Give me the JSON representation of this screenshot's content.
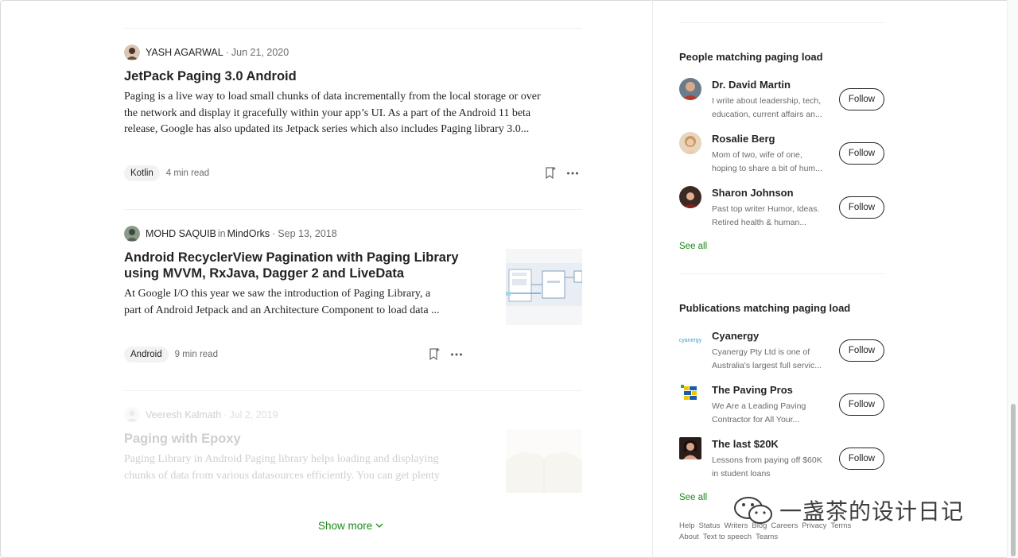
{
  "articles": [
    {
      "author": "YASH AGARWAL",
      "publication": "",
      "date": "Jun 21, 2020",
      "title_lines": [
        "JetPack Paging 3.0 Android"
      ],
      "excerpt_lines": [
        "Paging is a live way to load small chunks of data incrementally from the local storage or over",
        "the network and display it gracefully within your app’s UI. As a part of the Android 11 beta",
        "release, Google has also updated its Jetpack series which also includes Paging library 3.0..."
      ],
      "tag": "Kotlin",
      "read_time": "4 min read"
    },
    {
      "author": "MOHD SAQUIB",
      "in_label": "in",
      "publication": "MindOrks",
      "date": "Sep 13, 2018",
      "title_lines": [
        "Android RecyclerView Pagination with Paging Library",
        "using MVVM, RxJava, Dagger 2 and LiveData"
      ],
      "excerpt_lines": [
        "At Google I/O this year we saw the introduction of Paging Library, a",
        "part of Android Jetpack and an Architecture Component to load data ..."
      ],
      "tag": "Android",
      "read_time": "9 min read"
    },
    {
      "author": "Veeresh Kalmath",
      "publication": "",
      "date": "Jul 2, 2019",
      "title_lines": [
        "Paging with Epoxy"
      ],
      "excerpt_lines": [
        "Paging Library in Android Paging library helps loading and displaying",
        "chunks of data from various datasources efficiently. You can get plenty"
      ]
    }
  ],
  "show_more": "Show more",
  "people": {
    "heading": "People matching paging load",
    "items": [
      {
        "name": "Dr. David Martin",
        "desc_lines": [
          "I write about leadership, tech,",
          "education, current affairs an..."
        ],
        "follow": "Follow"
      },
      {
        "name": "Rosalie Berg",
        "desc_lines": [
          "Mom of two, wife of one,",
          "hoping to share a bit of hum..."
        ],
        "follow": "Follow"
      },
      {
        "name": "Sharon Johnson",
        "desc_lines": [
          "Past top writer Humor, Ideas.",
          "Retired health & human..."
        ],
        "follow": "Follow"
      }
    ],
    "see_all": "See all"
  },
  "publications": {
    "heading": "Publications matching paging load",
    "items": [
      {
        "name": "Cyanergy",
        "logo_text": "cyanergy",
        "desc_lines": [
          "Cyanergy Pty Ltd is one of",
          "Australia's largest full servic..."
        ],
        "follow": "Follow"
      },
      {
        "name": "The Paving Pros",
        "desc_lines": [
          "We Are a Leading Paving",
          "Contractor for All Your..."
        ],
        "follow": "Follow"
      },
      {
        "name": "The last $20K",
        "desc_lines": [
          "Lessons from paying off $60K",
          "in student loans"
        ],
        "follow": "Follow"
      }
    ],
    "see_all": "See all"
  },
  "footer": {
    "row1": [
      "Help",
      "Status",
      "Writers",
      "Blog",
      "Careers",
      "Privacy",
      "Terms"
    ],
    "row2": [
      "About",
      "Text to speech",
      "Teams"
    ]
  },
  "watermark": "一盏茶的设计日记",
  "colors": {
    "accent_green": "#1a8917",
    "text": "#242424",
    "muted": "#6b6b6b"
  }
}
